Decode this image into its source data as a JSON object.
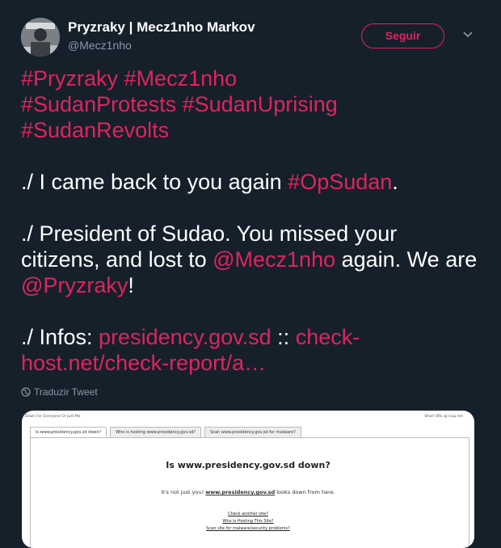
{
  "author": {
    "display_name": "Pryzraky | Mecz1nho Markov",
    "handle": "@Mecz1nho"
  },
  "follow_label": "Seguir",
  "tweet": {
    "hashtags_line1": [
      "#Pryzraky",
      "#Mecz1nho"
    ],
    "hashtags_line2": [
      "#SudanProtests",
      "#SudanUprising"
    ],
    "hashtags_line3": "#SudanRevolts",
    "p1_text": "./ I came back to you again ",
    "p1_tag": "#OpSudan",
    "p1_end": ".",
    "p2_text": "./ President of Sudao. You missed your citizens, and lost to ",
    "p2_mention1": "@Mecz1nho",
    "p2_mid": " again. We are ",
    "p2_mention2": "@Pryzraky",
    "p2_end": "!",
    "p3_text": "./ Infos: ",
    "p3_link1": "presidency.gov.sd",
    "p3_sep": " :: ",
    "p3_link2": "check-host.net/check-report/a…"
  },
  "translate_label": "Traduzir Tweet",
  "card": {
    "top_left": "Down For Everyone Or Just Me",
    "top_right": "Short URL @ isup.me",
    "tabs": [
      "Is www.presidency.gov.sd down?",
      "Who is hosting www.presidency.gov.sd?",
      "Scan www.presidency.gov.sd for malware?"
    ],
    "headline": "Is www.presidency.gov.sd down?",
    "sub_prefix": "It's not just you! ",
    "sub_link": "www.presidency.gov.sd",
    "sub_suffix": " looks down from here.",
    "links": [
      "Check another site?",
      "Who Is Hosting This Site?",
      "Scan site for malware/security problems?"
    ]
  },
  "colors": {
    "background": "#15202b",
    "accent": "#e0245e",
    "secondary_text": "#8899a6"
  }
}
